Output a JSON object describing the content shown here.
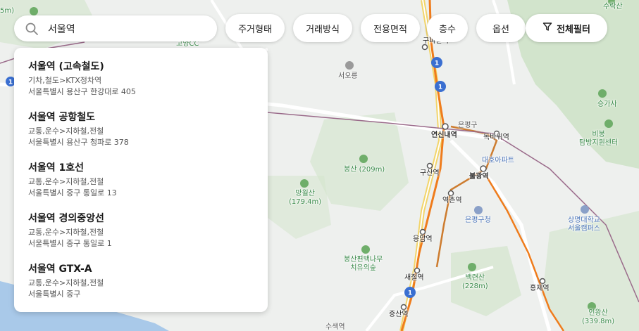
{
  "search": {
    "value": "서울역",
    "placeholder": ""
  },
  "filters": [
    "주거형태",
    "거래방식",
    "전용면적",
    "층수",
    "옵션"
  ],
  "all_filter_label": "전체필터",
  "suggestions": [
    {
      "title": "서울역 (고속철도)",
      "category": "기차,철도>KTX정차역",
      "address": "서울특별시 용산구 한강대로 405"
    },
    {
      "title": "서울역 공항철도",
      "category": "교통,운수>지하철,전철",
      "address": "서울특별시 용산구 청파로 378"
    },
    {
      "title": "서울역 1호선",
      "category": "교통,운수>지하철,전철",
      "address": "서울특별시 중구 통일로 13"
    },
    {
      "title": "서울역 경의중앙선",
      "category": "교통,운수>지하철,전철",
      "address": "서울특별시 중구 통일로 1"
    },
    {
      "title": "서울역 GTX-A",
      "category": "교통,운수>지하철,전철",
      "address": "서울특별시 중구"
    }
  ],
  "map": {
    "labels": {
      "suraksan": "수락산",
      "goyang_cc": "고양CC",
      "seooreung": "서오릉",
      "bongsan": "봉산 (209m)",
      "mangwolsan": "망월산\n(179.4m)",
      "bongsan_forest": "봉산편백나무\n치유의숲",
      "gupabal": "구파발역",
      "eunpyeong_gu": "은평구",
      "yeonsinnae": "연신내역",
      "dokbawi": "독바위역",
      "daeho_apt": "대호아파트",
      "bulgwang": "불광역",
      "gusan": "구산역",
      "yeokchon": "역촌역",
      "eunpyeong_office": "은평구청",
      "eungam": "응암역",
      "saejeol": "새절역",
      "jeungsan": "증산역",
      "baengnyeonsan": "백련산\n(228m)",
      "hongje": "홍제역",
      "inwangsan": "인왕산\n(339.8m)",
      "sangmyung": "상명대학교\n서울캠퍼스",
      "seunggasa": "승가사",
      "bibong": "비봉\n탐방지원센터",
      "top_left_elev": "5m)",
      "susaek": "수색역"
    },
    "route_badge": "1",
    "colors": {
      "line3": "#ef7c1c",
      "line6": "#cd7c2f",
      "gtx": "#9a6a8a",
      "water": "#a9c9e9",
      "park": "#cfe3c8",
      "road": "#f2d56b"
    }
  }
}
